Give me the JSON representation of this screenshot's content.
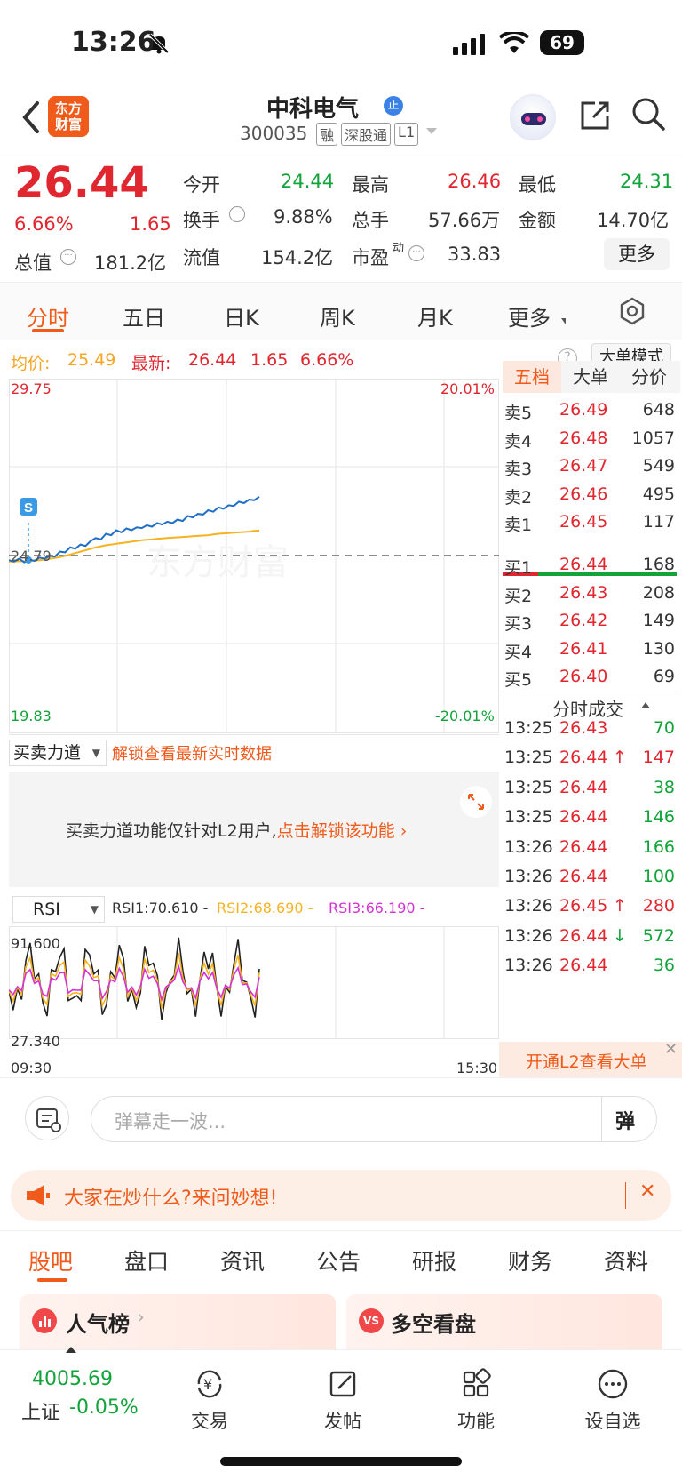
{
  "status": {
    "time": "13:26",
    "battery": "69"
  },
  "nav": {
    "logo_line1": "东方",
    "logo_line2": "财富",
    "stock_name": "中科电气",
    "stock_code": "300035",
    "tags": [
      "融",
      "深股通",
      "L1"
    ]
  },
  "quote": {
    "price": "26.44",
    "change_pct": "6.66%",
    "change": "1.65",
    "open_label": "今开",
    "open": "24.44",
    "high_label": "最高",
    "high": "26.46",
    "low_label": "最低",
    "low": "24.31",
    "turnover_label": "换手",
    "turnover": "9.88%",
    "volume_label": "总手",
    "volume": "57.66万",
    "amount_label": "金额",
    "amount": "14.70亿",
    "mcap_label": "总值",
    "mcap": "181.2亿",
    "float_label": "流值",
    "float": "154.2亿",
    "pe_label": "市盈",
    "pe_sup": "动",
    "pe": "33.83",
    "more": "更多"
  },
  "tabs": [
    "分时",
    "五日",
    "日K",
    "周K",
    "月K",
    "更多"
  ],
  "chart_info": {
    "avg_label": "均价:",
    "avg": "25.49",
    "latest_label": "最新:",
    "latest": "26.44",
    "chg": "1.65",
    "pct": "6.66%",
    "bigorder_btn": "大单模式"
  },
  "chart_data": {
    "type": "line",
    "title": "",
    "y_max": "29.75",
    "y_min": "19.83",
    "y_ref": "24.79",
    "pct_max": "20.01%",
    "pct_min": "-20.01%",
    "x_start": "09:30",
    "x_end": "15:30",
    "ylim": [
      19.83,
      29.75
    ],
    "series": [
      {
        "name": "最新",
        "color": "#1f6fc7",
        "values": [
          24.66,
          24.62,
          24.7,
          24.6,
          24.68,
          24.64,
          24.73,
          24.7,
          24.78,
          24.76,
          24.9,
          24.88,
          25.02,
          24.98,
          25.1,
          25.06,
          25.2,
          25.28,
          25.24,
          25.4,
          25.36,
          25.5,
          25.44,
          25.55,
          25.5,
          25.58,
          25.56,
          25.64,
          25.6,
          25.7,
          25.66,
          25.74,
          25.7,
          25.8,
          25.76,
          25.9,
          25.86,
          25.96,
          25.94,
          26.06,
          26.02,
          26.14,
          26.1,
          26.2,
          26.18,
          26.3,
          26.26,
          26.36,
          26.34,
          26.44
        ]
      },
      {
        "name": "均价",
        "color": "#f5b321",
        "values": [
          24.62,
          24.62,
          24.63,
          24.63,
          24.64,
          24.65,
          24.66,
          24.68,
          24.7,
          24.72,
          24.75,
          24.78,
          24.82,
          24.86,
          24.9,
          24.94,
          24.98,
          25.02,
          25.05,
          25.08,
          25.1,
          25.12,
          25.14,
          25.16,
          25.18,
          25.2,
          25.22,
          25.23,
          25.24,
          25.26,
          25.27,
          25.28,
          25.29,
          25.3,
          25.31,
          25.32,
          25.33,
          25.34,
          25.35,
          25.36,
          25.38,
          25.4,
          25.41,
          25.42,
          25.43,
          25.44,
          25.45,
          25.46,
          25.48,
          25.49
        ]
      }
    ]
  },
  "orderbook": {
    "tabs": [
      "五档",
      "大单",
      "分价"
    ],
    "asks": [
      {
        "label": "卖5",
        "price": "26.49",
        "vol": "648"
      },
      {
        "label": "卖4",
        "price": "26.48",
        "vol": "1057"
      },
      {
        "label": "卖3",
        "price": "26.47",
        "vol": "549"
      },
      {
        "label": "卖2",
        "price": "26.46",
        "vol": "495"
      },
      {
        "label": "卖1",
        "price": "26.45",
        "vol": "117"
      }
    ],
    "bids": [
      {
        "label": "买1",
        "price": "26.44",
        "vol": "168"
      },
      {
        "label": "买2",
        "price": "26.43",
        "vol": "208"
      },
      {
        "label": "买3",
        "price": "26.42",
        "vol": "149"
      },
      {
        "label": "买4",
        "price": "26.41",
        "vol": "130"
      },
      {
        "label": "买5",
        "price": "26.40",
        "vol": "69"
      }
    ]
  },
  "deals": {
    "title": "分时成交",
    "rows": [
      {
        "time": "13:25",
        "price": "26.43",
        "arrow": "",
        "vol": "70",
        "vcolor": "green"
      },
      {
        "time": "13:25",
        "price": "26.44",
        "arrow": "↑",
        "vol": "147",
        "vcolor": "red"
      },
      {
        "time": "13:25",
        "price": "26.44",
        "arrow": "",
        "vol": "38",
        "vcolor": "green"
      },
      {
        "time": "13:25",
        "price": "26.44",
        "arrow": "",
        "vol": "146",
        "vcolor": "green"
      },
      {
        "time": "13:26",
        "price": "26.44",
        "arrow": "",
        "vol": "166",
        "vcolor": "green"
      },
      {
        "time": "13:26",
        "price": "26.44",
        "arrow": "",
        "vol": "100",
        "vcolor": "green"
      },
      {
        "time": "13:26",
        "price": "26.45",
        "arrow": "↑",
        "vol": "280",
        "vcolor": "red"
      },
      {
        "time": "13:26",
        "price": "26.44",
        "arrow": "↓",
        "vol": "572",
        "vcolor": "green"
      },
      {
        "time": "13:26",
        "price": "26.44",
        "arrow": "",
        "vol": "36",
        "vcolor": "green"
      }
    ],
    "l2_banner": "开通L2查看大单"
  },
  "force": {
    "select": "买卖力道",
    "unlock_link": "解锁查看最新实时数据",
    "msg": "买卖力道功能仅针对L2用户,",
    "msg_link": "点击解锁该功能"
  },
  "rsi": {
    "select": "RSI",
    "rsi1": "RSI1:70.610 -",
    "rsi2": "RSI2:68.690 -",
    "rsi3": "RSI3:66.190 -",
    "max": "91.600",
    "min": "27.340",
    "x_start": "09:30",
    "x_end": "15:30"
  },
  "danmaku": {
    "placeholder": "弹幕走一波...",
    "btn": "弹"
  },
  "banner": {
    "text": "大家在炒什么?来问妙想!"
  },
  "subtabs": [
    "股吧",
    "盘口",
    "资讯",
    "公告",
    "研报",
    "财务",
    "资料"
  ],
  "cards": [
    {
      "title": "人气榜"
    },
    {
      "title": "多空看盘"
    }
  ],
  "bottom": {
    "index_value": "4005.69",
    "index_name": "上证",
    "index_change": "-0.05%",
    "items": [
      "交易",
      "发帖",
      "功能",
      "设自选"
    ]
  }
}
